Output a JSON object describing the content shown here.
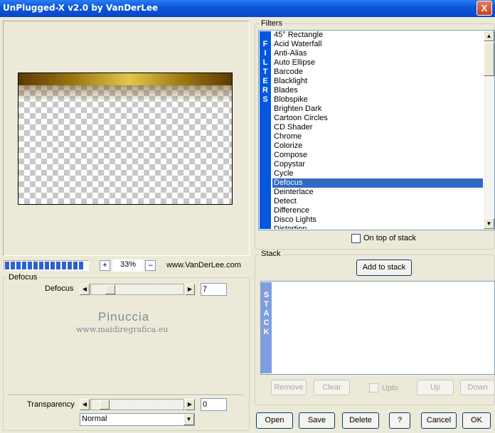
{
  "window": {
    "title": "UnPlugged-X v2.0 by VanDerLee",
    "close_label": "X"
  },
  "toolbar": {
    "zoom_in": "+",
    "zoom_value": "33%",
    "zoom_out": "–",
    "website": "www.VanDerLee.com",
    "progress_blocks": 14
  },
  "params": {
    "group_label": "Defocus",
    "defocus": {
      "label": "Defocus",
      "value": "7",
      "level": 0.07
    },
    "transparency": {
      "label": "Transparency",
      "value": "0",
      "level": 0
    },
    "blend_mode": "Normal"
  },
  "watermark": {
    "line1": "Pinuccia",
    "line2": "www.maidiregrafica.eu"
  },
  "filters": {
    "group_label": "Filters",
    "strip_letters": [
      "F",
      "I",
      "L",
      "T",
      "E",
      "R",
      "S"
    ],
    "items": [
      "45° Rectangle",
      "Acid Waterfall",
      "Anti-Alias",
      "Auto Ellipse",
      "Barcode",
      "Blacklight",
      "Blades",
      "Blobspike",
      "Brighten Dark",
      "Cartoon Circles",
      "CD Shader",
      "Chrome",
      "Colorize",
      "Compose",
      "Copystar",
      "Cycle",
      "Defocus",
      "Deinterlace",
      "Detect",
      "Difference",
      "Disco Lights",
      "Distortion"
    ],
    "selected": "Defocus",
    "on_top_label": "On top of stack",
    "scroll_up": "▲",
    "scroll_down": "▼"
  },
  "stack": {
    "group_label": "Stack",
    "add_label": "Add to stack",
    "strip_letters": [
      "S",
      "T",
      "A",
      "C",
      "K"
    ],
    "remove_label": "Remove",
    "clear_label": "Clear",
    "upto_label": "Upto",
    "up_label": "Up",
    "down_label": "Down"
  },
  "buttons": {
    "open": "Open",
    "save": "Save",
    "delete": "Delete",
    "help": "?",
    "cancel": "Cancel",
    "ok": "OK"
  },
  "colors": {
    "title_bar": "#0a54d8",
    "selection": "#316ac5",
    "filter_strip": "#0058e0",
    "stack_strip": "#7f9ee0"
  }
}
